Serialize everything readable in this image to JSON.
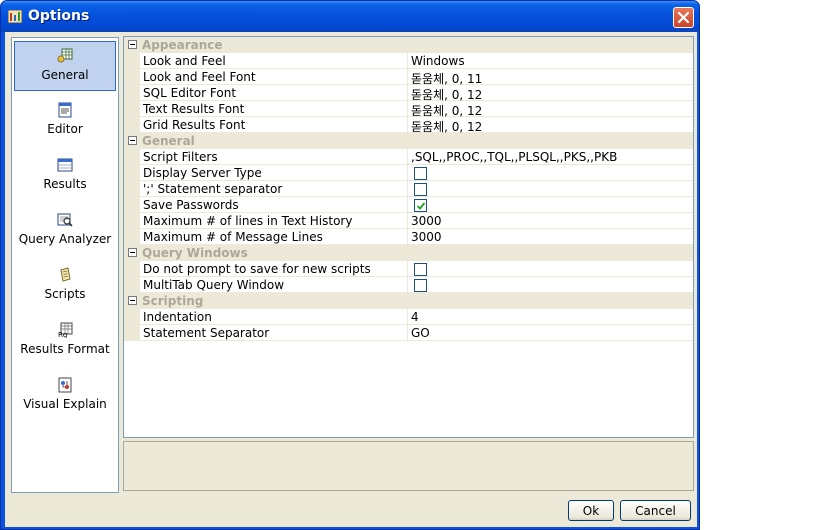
{
  "window": {
    "title": "Options"
  },
  "sidebar": {
    "items": [
      {
        "label": "General",
        "icon": "general-icon",
        "selected": true
      },
      {
        "label": "Editor",
        "icon": "editor-icon"
      },
      {
        "label": "Results",
        "icon": "results-icon"
      },
      {
        "label": "Query Analyzer",
        "icon": "query-analyzer-icon"
      },
      {
        "label": "Scripts",
        "icon": "scripts-icon"
      },
      {
        "label": "Results Format",
        "icon": "results-format-icon"
      },
      {
        "label": "Visual Explain",
        "icon": "visual-explain-icon"
      }
    ]
  },
  "grid": {
    "categories": [
      {
        "label": "Appearance",
        "props": [
          {
            "name": "Look and Feel",
            "value": "Windows"
          },
          {
            "name": "Look and Feel Font",
            "value": "돋움체, 0, 11"
          },
          {
            "name": "SQL Editor Font",
            "value": "돋움체, 0, 12"
          },
          {
            "name": "Text Results Font",
            "value": "돋움체, 0, 12"
          },
          {
            "name": "Grid Results Font",
            "value": "돋움체, 0, 12"
          }
        ]
      },
      {
        "label": "General",
        "props": [
          {
            "name": "Script Filters",
            "value": ",SQL,,PROC,,TQL,,PLSQL,,PKS,,PKB"
          },
          {
            "name": "Display Server Type",
            "checkbox": true,
            "checked": false
          },
          {
            "name": "';' Statement separator",
            "checkbox": true,
            "checked": false
          },
          {
            "name": "Save Passwords",
            "checkbox": true,
            "checked": true
          },
          {
            "name": "Maximum # of lines in Text History",
            "value": "3000"
          },
          {
            "name": "Maximum # of Message Lines",
            "value": "3000"
          }
        ]
      },
      {
        "label": "Query Windows",
        "props": [
          {
            "name": "Do not prompt to save for new scripts",
            "checkbox": true,
            "checked": false
          },
          {
            "name": "MultiTab Query Window",
            "checkbox": true,
            "checked": false
          }
        ]
      },
      {
        "label": "Scripting",
        "props": [
          {
            "name": "Indentation",
            "value": "4"
          },
          {
            "name": "Statement Separator",
            "value": "GO"
          }
        ]
      }
    ]
  },
  "buttons": {
    "ok": "Ok",
    "cancel": "Cancel"
  }
}
